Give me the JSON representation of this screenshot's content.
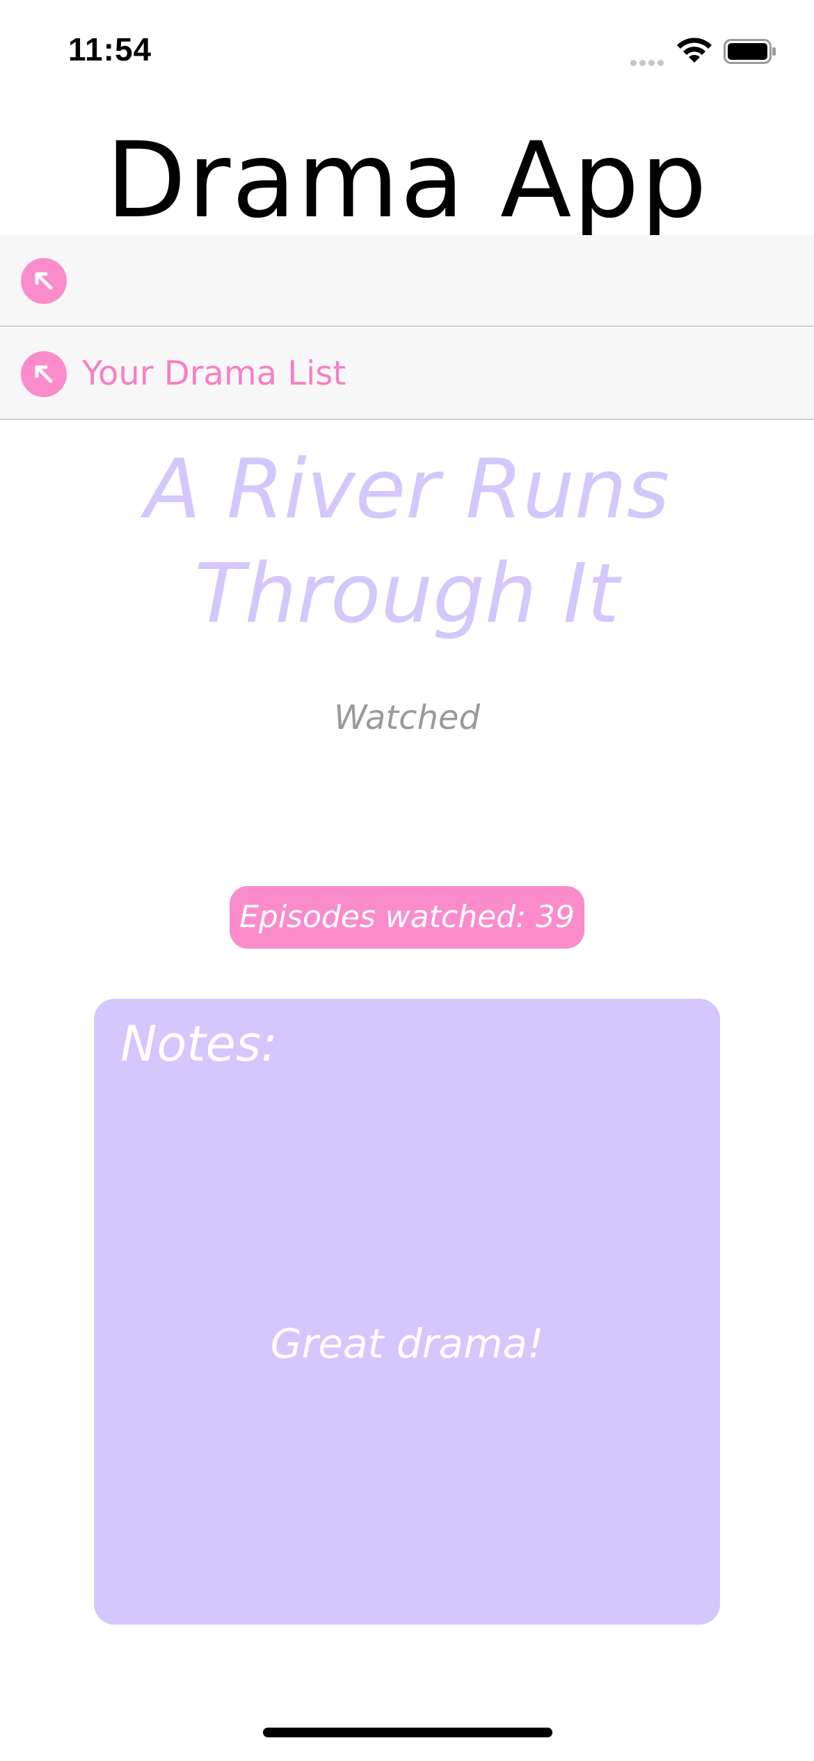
{
  "status_bar": {
    "time": "11:54",
    "icons": [
      "signal-icon",
      "wifi-icon",
      "battery-icon"
    ]
  },
  "app": {
    "title": "Drama App"
  },
  "nav": {
    "rows": [
      {
        "icon": "back-arrow-icon",
        "label": ""
      },
      {
        "icon": "back-arrow-icon",
        "label": "Your Drama List"
      }
    ]
  },
  "detail": {
    "title": "A River Runs Through It",
    "status": "Watched",
    "episodes_label": "Episodes watched: 39",
    "notes_label": "Notes:",
    "notes_text": "Great drama!"
  },
  "colors": {
    "accent_pink": "#fa8ccc",
    "accent_lavender": "#d3c7fd",
    "title_lavender": "#d3c7fb",
    "nav_background": "#f7f7f7"
  }
}
